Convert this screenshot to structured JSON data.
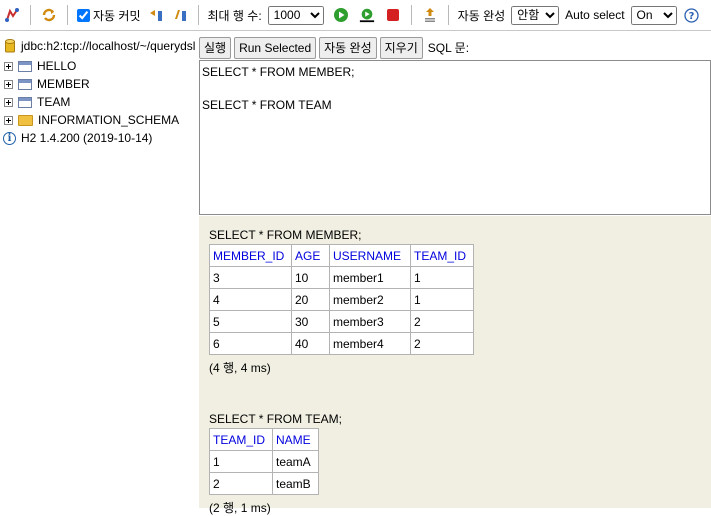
{
  "toolbar": {
    "autocommit_label": "자동 커밋",
    "autocommit_checked": true,
    "max_rows_label": "최대 행 수:",
    "max_rows_value": "1000",
    "autocomplete_label": "자동 완성",
    "autocomplete_value": "안함",
    "autoselect_label": "Auto select",
    "autoselect_value": "On",
    "colors": {
      "run_green": "#2e9e2e",
      "stop_red": "#d42020"
    }
  },
  "tree": {
    "connection": "jdbc:h2:tcp://localhost/~/querydsl",
    "items": [
      {
        "label": "HELLO",
        "icon": "table-icon"
      },
      {
        "label": "MEMBER",
        "icon": "table-icon"
      },
      {
        "label": "TEAM",
        "icon": "table-icon"
      },
      {
        "label": "INFORMATION_SCHEMA",
        "icon": "folder-icon"
      }
    ],
    "version": "H2 1.4.200 (2019-10-14)"
  },
  "commands": {
    "run": "실행",
    "run_selected": "Run Selected",
    "autocomplete": "자동 완성",
    "clear": "지우기",
    "sql_label": "SQL 문:"
  },
  "editor": {
    "text": "SELECT * FROM MEMBER;\n\nSELECT * FROM TEAM"
  },
  "results": [
    {
      "query": "SELECT * FROM MEMBER;",
      "columns": [
        "MEMBER_ID",
        "AGE",
        "USERNAME",
        "TEAM_ID"
      ],
      "rows": [
        [
          "3",
          "10",
          "member1",
          "1"
        ],
        [
          "4",
          "20",
          "member2",
          "1"
        ],
        [
          "5",
          "30",
          "member3",
          "2"
        ],
        [
          "6",
          "40",
          "member4",
          "2"
        ]
      ],
      "summary": "(4 행, 4 ms)"
    },
    {
      "query": "SELECT * FROM TEAM;",
      "columns": [
        "TEAM_ID",
        "NAME"
      ],
      "rows": [
        [
          "1",
          "teamA"
        ],
        [
          "2",
          "teamB"
        ]
      ],
      "summary": "(2 행, 1 ms)"
    }
  ]
}
